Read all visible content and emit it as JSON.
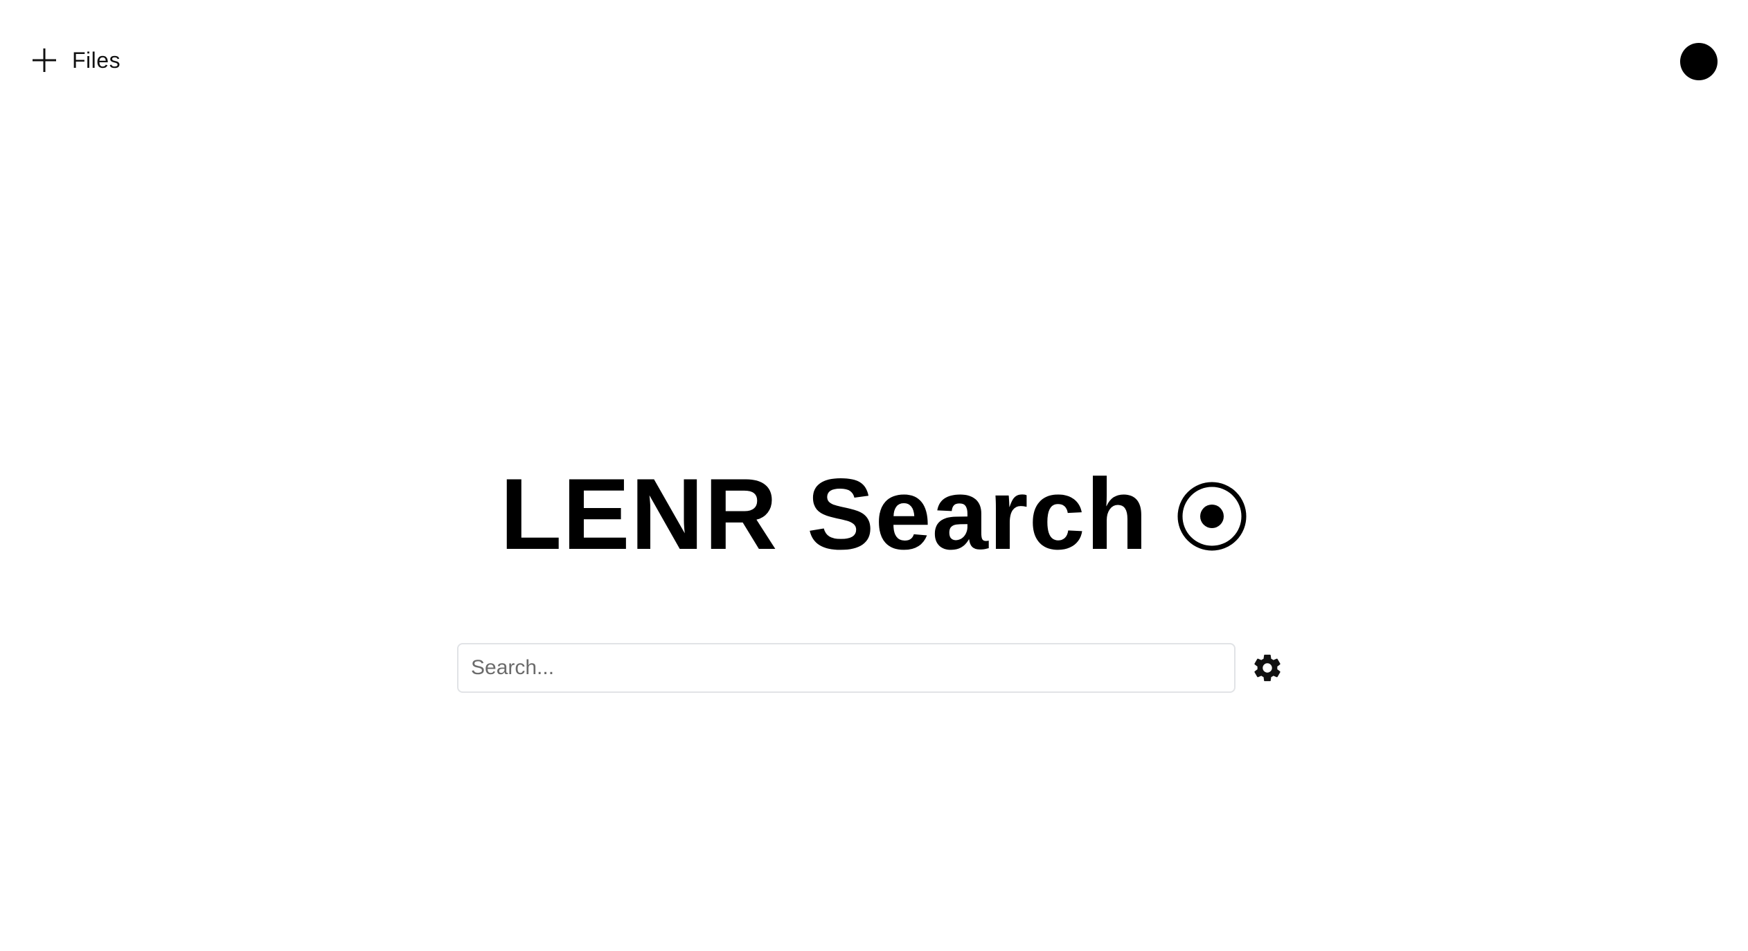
{
  "header": {
    "files_label": "Files",
    "files_icon": "plus-icon",
    "avatar_icon": "avatar-dot"
  },
  "main": {
    "title": "LENR Search",
    "title_icon": "target-icon",
    "search": {
      "value": "",
      "placeholder": "Search..."
    },
    "settings_icon": "gear-icon"
  },
  "colors": {
    "background": "#ffffff",
    "text": "#000000",
    "input_border": "#e1e3e6",
    "placeholder": "#6b6b6b"
  }
}
